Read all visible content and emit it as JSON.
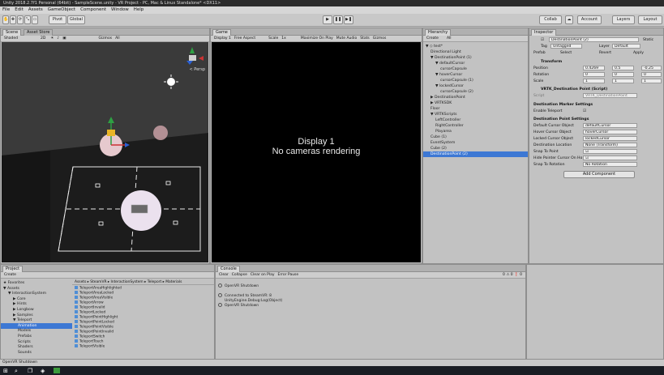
{
  "window": {
    "title": "Unity 2018.2.7f1 Personal (64bit) - SampleScene.unity - VR Project - PC, Mac & Linux Standalone* <DX11>"
  },
  "menu": [
    "File",
    "Edit",
    "Assets",
    "GameObject",
    "Component",
    "Window",
    "Help"
  ],
  "toolbar": {
    "pivot": "Pivot",
    "global": "Global",
    "collab": "Collab",
    "account": "Account",
    "layers": "Layers",
    "layout": "Layout"
  },
  "scene": {
    "tab": "Scene",
    "tab2": "Asset Store",
    "shaded": "Shaded",
    "mode2d": "2D",
    "gizmos": "Gizmos",
    "search": "All",
    "persp": "< Persp"
  },
  "game": {
    "tab": "Game",
    "display": "Display 1",
    "aspect": "Free Aspect",
    "scale": "Scale",
    "scale_val": "1x",
    "maximize": "Maximize On Play",
    "mute": "Mute Audio",
    "stats": "Stats",
    "gizmos": "Gizmos",
    "message_line1": "Display 1",
    "message_line2": "No cameras rendering"
  },
  "hierarchy": {
    "tab": "Hierarchy",
    "create": "Create",
    "search": "All",
    "items": [
      {
        "label": "▼ ◇ test*",
        "indent": 0,
        "sel": false
      },
      {
        "label": "Directional Light",
        "indent": 1,
        "sel": false
      },
      {
        "label": "▼ DestinationPoint (1)",
        "indent": 1,
        "sel": false
      },
      {
        "label": "▼ defaultCursor",
        "indent": 2,
        "sel": false
      },
      {
        "label": "cursorCapsule",
        "indent": 3,
        "sel": false
      },
      {
        "label": "▼ hoverCursor",
        "indent": 2,
        "sel": false
      },
      {
        "label": "cursorCapsule (1)",
        "indent": 3,
        "sel": false
      },
      {
        "label": "▼ lockedCursor",
        "indent": 2,
        "sel": false
      },
      {
        "label": "cursorCapsule (2)",
        "indent": 3,
        "sel": false
      },
      {
        "label": "▶ DestinationPoint",
        "indent": 1,
        "sel": false
      },
      {
        "label": "▶ VRTKSDK",
        "indent": 1,
        "sel": false
      },
      {
        "label": "Floor",
        "indent": 1,
        "sel": false
      },
      {
        "label": "▼ VRTKScripts",
        "indent": 1,
        "sel": false
      },
      {
        "label": "LeftController",
        "indent": 2,
        "sel": false
      },
      {
        "label": "RightController",
        "indent": 2,
        "sel": false
      },
      {
        "label": "Playarea",
        "indent": 2,
        "sel": false
      },
      {
        "label": "Cube (1)",
        "indent": 1,
        "sel": false
      },
      {
        "label": "EventSystem",
        "indent": 1,
        "sel": false
      },
      {
        "label": "Cube (2)",
        "indent": 1,
        "sel": false
      },
      {
        "label": "DestinationPoint (2)",
        "indent": 1,
        "sel": true
      }
    ]
  },
  "inspector": {
    "tab": "Inspector",
    "object_name": "DestinationPoint (2)",
    "static": "Static",
    "tag_label": "Tag",
    "tag_value": "Untagged",
    "layer_label": "Layer",
    "layer_value": "Default",
    "prefab_label": "Prefab",
    "prefab_select": "Select",
    "prefab_revert": "Revert",
    "prefab_apply": "Apply",
    "transform_title": "Transform",
    "position": "Position",
    "rotation": "Rotation",
    "scale": "Scale",
    "pos_x": "0.4269",
    "pos_y": "0.5",
    "pos_z": "-0.25",
    "rot_x": "0",
    "rot_y": "0",
    "rot_z": "0",
    "scl_x": "1",
    "scl_y": "1",
    "scl_z": "1",
    "script_title": "VRTK_Destination Point (Script)",
    "script_label": "Script",
    "script_value": "VRTK_DestinationPoint",
    "section1": "Destination Marker Settings",
    "enable_teleport": "Enable Teleport",
    "section2": "Destination Point Settings",
    "fields": [
      {
        "label": "Default Cursor Object",
        "value": "defaultCursor"
      },
      {
        "label": "Hover Cursor Object",
        "value": "hoverCursor"
      },
      {
        "label": "Locked Cursor Object",
        "value": "lockedCursor"
      },
      {
        "label": "Destination Location",
        "value": "None (Transform)"
      },
      {
        "label": "Snap To Point",
        "value": "☑"
      },
      {
        "label": "Hide Pointer Cursor On Ho",
        "value": "☑"
      },
      {
        "label": "Snap To Rotation",
        "value": "No Rotation"
      }
    ],
    "add_component": "Add Component"
  },
  "project": {
    "tab": "Project",
    "create": "Create",
    "tree": [
      {
        "label": "★ Favorites",
        "indent": 0
      },
      {
        "label": "▼ Assets",
        "indent": 0
      },
      {
        "label": "▼ InteractionSystem",
        "indent": 1
      },
      {
        "label": "▶ Core",
        "indent": 2
      },
      {
        "label": "▶ Hints",
        "indent": 2
      },
      {
        "label": "▶ Longbow",
        "indent": 2
      },
      {
        "label": "▶ Samples",
        "indent": 2
      },
      {
        "label": "▼ Teleport",
        "indent": 2
      },
      {
        "label": "Animation",
        "indent": 3
      },
      {
        "label": "Models",
        "indent": 3
      },
      {
        "label": "Prefabs",
        "indent": 3
      },
      {
        "label": "Scripts",
        "indent": 3
      },
      {
        "label": "Shaders",
        "indent": 3
      },
      {
        "label": "Sounds",
        "indent": 3
      }
    ],
    "breadcrumb": "Assets ▸ SteamVR ▸ InteractionSystem ▸ Teleport ▸ Materials",
    "assets": [
      "TeleportAreaHighlighted",
      "TeleportAreaLocked",
      "TeleportAreaVisible",
      "TeleportArrow",
      "TeleportInvalid",
      "TeleportLocked",
      "TeleportPointHighlight",
      "TeleportPointLocked",
      "TeleportPointVisible",
      "TeleportPointInvalid",
      "TeleportSwitch",
      "TeleportTouch",
      "TeleportVisible"
    ]
  },
  "console": {
    "tab": "Console",
    "clear": "Clear",
    "collapse": "Collapse",
    "clear_play": "Clear on Play",
    "error_pause": "Error Pause",
    "counts": "0 ⚠ 0 ❗ 0",
    "messages": [
      {
        "line1": "OpenVR Shutdown",
        "line2": ""
      },
      {
        "line1": "Connected to SteamVR: 8",
        "line2": "UnityEngine.Debug:Log(Object)"
      },
      {
        "line1": "OpenVR Shutdown",
        "line2": ""
      }
    ]
  },
  "statusbar": {
    "text": "OpenVR Shutdown"
  },
  "colors": {
    "selection": "#3d78d4",
    "editor_bg": "#c2c2c2",
    "scene_bg": "#3a3a3a",
    "game_bg": "#000000",
    "taskbar": "#1a1d24"
  }
}
